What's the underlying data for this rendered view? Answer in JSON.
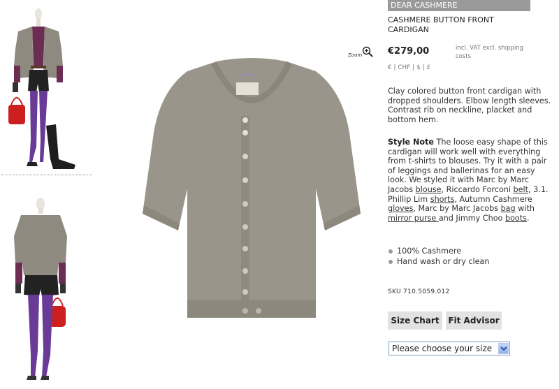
{
  "header": {
    "brand": "DEAR CASHMERE",
    "product_title": "CASHMERE BUTTON FRONT CARDIGAN"
  },
  "price": {
    "amount": "€279,00",
    "vat_note": "incl. VAT excl. shipping costs",
    "currencies": [
      "€",
      "CHF",
      "$",
      "£"
    ]
  },
  "zoom": {
    "label": "Zoom",
    "icon": "magnifier-plus-icon"
  },
  "description": "Clay colored button front cardigan with dropped shoulders. Elbow length sleeves. Contrast rib on neckline, placket and bottom hem.",
  "style_note": {
    "heading": "Style Note",
    "t1": " The loose easy shape of this cardigan will work well with everything from t-shirts to blouses. Try it with a pair of leggings and ballerinas for an easy look. We styled it with Marc by Marc Jacobs ",
    "link_blouse": "blouse",
    "t2": ", Riccardo Forconi ",
    "link_belt": "belt",
    "t3": ", 3.1. Phillip Lim ",
    "link_shorts": "shorts",
    "t4": ", Autumn Cashmere ",
    "link_gloves": "gloves",
    "t5": ", Marc by Marc Jacobs ",
    "link_bag": "bag",
    "t6": "  with ",
    "link_purse": "mirror purse ",
    "t7": "and Jimmy Choo ",
    "link_boots": "boots",
    "t8": "."
  },
  "details": [
    "100% Cashmere",
    "Hand wash or dry clean"
  ],
  "sku": "SKU 710.5059.012",
  "buttons": {
    "size_chart": "Size Chart",
    "fit_advisor": "Fit Advisor"
  },
  "size_select": {
    "selected": "Please choose your size"
  },
  "colors": {
    "cardigan": "#9a958a",
    "brand_bar": "#9a9a9a",
    "button_bg": "#e2e2e2",
    "tights": "#6a3b96",
    "bag": "#cc1f1f"
  }
}
